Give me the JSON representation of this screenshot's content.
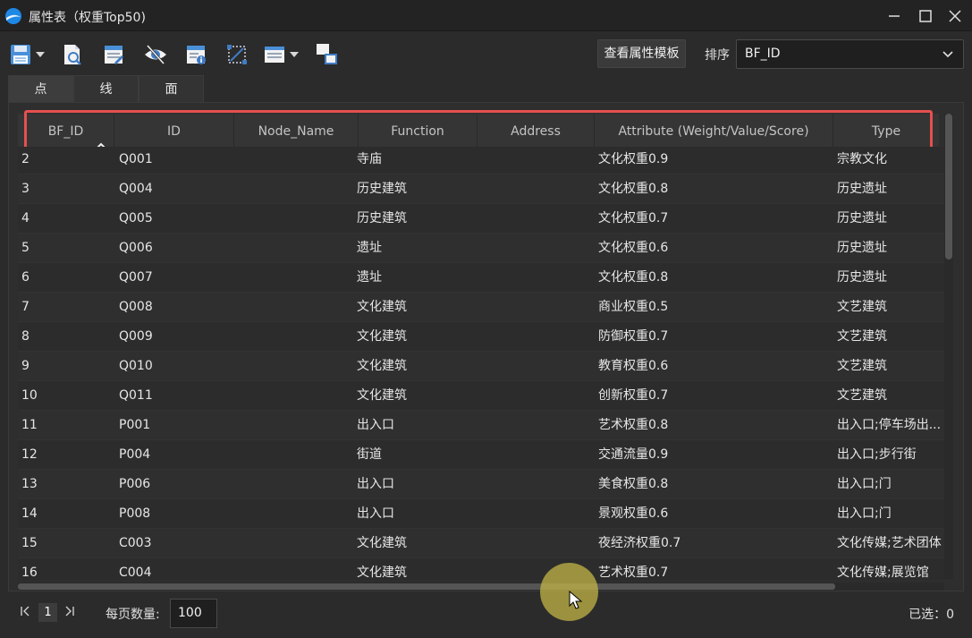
{
  "window": {
    "title": "属性表（权重Top50)",
    "buttons": [
      "minimize-icon",
      "maximize-icon",
      "close-icon"
    ]
  },
  "toolbar": {
    "icons": [
      "save-icon",
      "preview-icon",
      "edit-table-icon",
      "visibility-icon",
      "field-info-icon",
      "select-all-icon",
      "columns-icon",
      "copy-icon"
    ],
    "template_button": "查看属性模板",
    "sort_label": "排序",
    "sort_value": "BF_ID"
  },
  "tabs": [
    {
      "label": "点",
      "active": true
    },
    {
      "label": "线",
      "active": false
    },
    {
      "label": "面",
      "active": false
    }
  ],
  "table": {
    "columns": [
      "BF_ID",
      "ID",
      "Node_Name",
      "Function",
      "Address",
      "Attribute (Weight/Value/Score)",
      "Type"
    ],
    "sorted_column": "BF_ID",
    "sort_direction": "ascending",
    "rows": [
      [
        "2",
        "Q001",
        "",
        "寺庙",
        "",
        "文化权重0.9",
        "宗教文化"
      ],
      [
        "3",
        "Q004",
        "",
        "历史建筑",
        "",
        "文化权重0.8",
        "历史遗址"
      ],
      [
        "4",
        "Q005",
        "",
        "历史建筑",
        "",
        "文化权重0.7",
        "历史遗址"
      ],
      [
        "5",
        "Q006",
        "",
        "遗址",
        "",
        "文化权重0.6",
        "历史遗址"
      ],
      [
        "6",
        "Q007",
        "",
        "遗址",
        "",
        "文化权重0.8",
        "历史遗址"
      ],
      [
        "7",
        "Q008",
        "",
        "文化建筑",
        "",
        "商业权重0.5",
        "文艺建筑"
      ],
      [
        "8",
        "Q009",
        "",
        "文化建筑",
        "",
        "防御权重0.7",
        "文艺建筑"
      ],
      [
        "9",
        "Q010",
        "",
        "文化建筑",
        "",
        "教育权重0.6",
        "文艺建筑"
      ],
      [
        "10",
        "Q011",
        "",
        "文化建筑",
        "",
        "创新权重0.7",
        "文艺建筑"
      ],
      [
        "11",
        "P001",
        "",
        "出入口",
        "",
        "艺术权重0.8",
        "出入口;停车场出..."
      ],
      [
        "12",
        "P004",
        "",
        "街道",
        "",
        "交通流量0.9",
        "出入口;步行街"
      ],
      [
        "13",
        "P006",
        "",
        "出入口",
        "",
        "美食权重0.8",
        "出入口;门"
      ],
      [
        "14",
        "P008",
        "",
        "出入口",
        "",
        "景观权重0.6",
        "出入口;门"
      ],
      [
        "15",
        "C003",
        "",
        "文化建筑",
        "",
        "夜经济权重0.7",
        "文化传媒;艺术团体"
      ],
      [
        "16",
        "C004",
        "",
        "文化建筑",
        "",
        "艺术权重0.7",
        "文化传媒;展览馆"
      ]
    ]
  },
  "footer": {
    "current_page": "1",
    "per_page_label": "每页数量:",
    "per_page_value": "100",
    "selected_text": "已选：0"
  },
  "colors": {
    "background": "#2b2b2b",
    "highlight": "#e5504f",
    "logo": "#1e88e5"
  }
}
